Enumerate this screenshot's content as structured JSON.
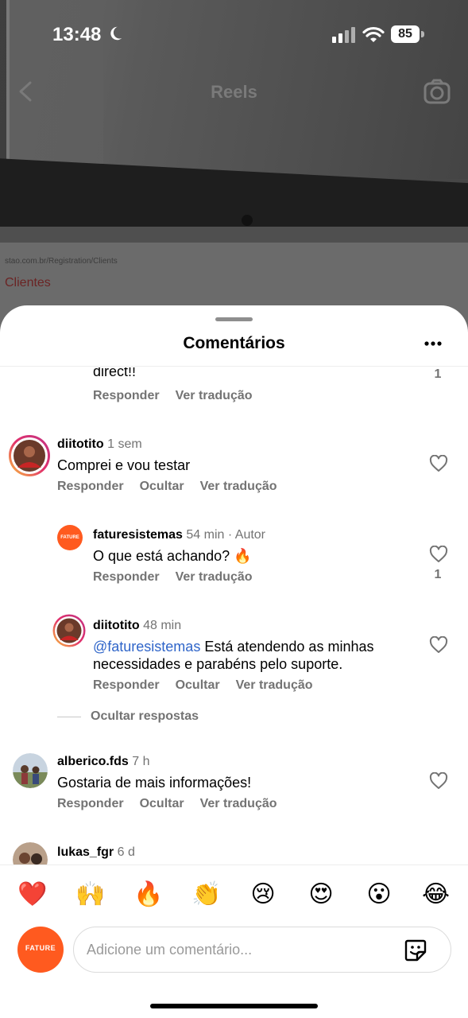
{
  "status_bar": {
    "time": "13:48",
    "battery": "85"
  },
  "header": {
    "title": "Reels"
  },
  "background": {
    "url_text": "stao.com.br/Registration/Clients",
    "page_title": "Clientes"
  },
  "sheet": {
    "title": "Comentários"
  },
  "comments": [
    {
      "text": "direct!!",
      "actions": [
        "Responder",
        "Ver tradução"
      ],
      "like_count": "1"
    },
    {
      "username": "diitotito",
      "meta": "1 sem",
      "text": "Comprei e vou testar",
      "actions": [
        "Responder",
        "Ocultar",
        "Ver tradução"
      ]
    },
    {
      "username": "faturesistemas",
      "meta": "54 min · Autor",
      "text": "O que está achando? 🔥",
      "actions": [
        "Responder",
        "Ver tradução"
      ],
      "like_count": "1",
      "avatar_text": "FATURE"
    },
    {
      "username": "diitotito",
      "meta": "48 min",
      "mention": "@faturesistemas",
      "text": " Está atendendo as minhas necessidades e parabéns pelo suporte.",
      "actions": [
        "Responder",
        "Ocultar",
        "Ver tradução"
      ]
    },
    {
      "username": "alberico.fds",
      "meta": "7 h",
      "text": "Gostaria de mais informações!",
      "actions": [
        "Responder",
        "Ocultar",
        "Ver tradução"
      ]
    },
    {
      "username": "lukas_fgr",
      "meta": "6 d"
    }
  ],
  "hide_replies": "Ocultar respostas",
  "reactions": [
    "❤️",
    "🙌",
    "🔥",
    "👏",
    "😢",
    "😍",
    "😮",
    "😂"
  ],
  "composer": {
    "placeholder": "Adicione um comentário...",
    "avatar_text": "FATURE"
  },
  "colors": {
    "mention": "#2f65c9",
    "brand": "#ff5a1f",
    "secondary_text": "#737373"
  }
}
